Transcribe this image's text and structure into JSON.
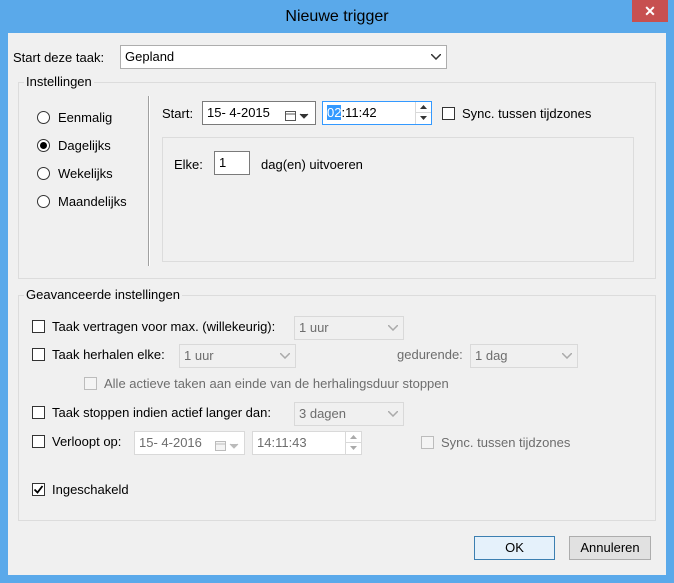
{
  "window": {
    "title": "Nieuwe trigger",
    "close_glyph": "✕"
  },
  "start_task": {
    "label": "Start deze taak:",
    "value": "Gepland"
  },
  "settings": {
    "group_label": "Instellingen",
    "radios": [
      {
        "label": "Eenmalig",
        "checked": false
      },
      {
        "label": "Dagelijks",
        "checked": true
      },
      {
        "label": "Wekelijks",
        "checked": false
      },
      {
        "label": "Maandelijks",
        "checked": false
      }
    ],
    "start_label": "Start:",
    "start_date": "15-  4-2015",
    "start_time_hour": "02",
    "start_time_rest": ":11:42",
    "sync_label": "Sync. tussen tijdzones",
    "every_label": "Elke:",
    "every_value": "1",
    "every_suffix": "dag(en) uitvoeren"
  },
  "advanced": {
    "group_label": "Geavanceerde instellingen",
    "delay_label": "Taak vertragen voor max. (willekeurig):",
    "delay_value": "1 uur",
    "repeat_label": "Taak herhalen elke:",
    "repeat_value": "1 uur",
    "duration_label": "gedurende:",
    "duration_value": "1 dag",
    "stop_all_label": "Alle actieve taken aan einde van de herhalingsduur stoppen",
    "stop_longer_label": "Taak stoppen indien actief langer dan:",
    "stop_longer_value": "3 dagen",
    "expires_label": "Verloopt op:",
    "expires_date": "15-  4-2016",
    "expires_time": "14:11:43",
    "expires_sync_label": "Sync. tussen tijdzones",
    "enabled_label": "Ingeschakeld",
    "enabled_checked": true
  },
  "buttons": {
    "ok": "OK",
    "cancel": "Annuleren"
  },
  "colors": {
    "title_bar": "#5aa9ea",
    "close_button": "#c75050",
    "selection": "#3399ff",
    "dialog_bg": "#f0f0f0"
  }
}
